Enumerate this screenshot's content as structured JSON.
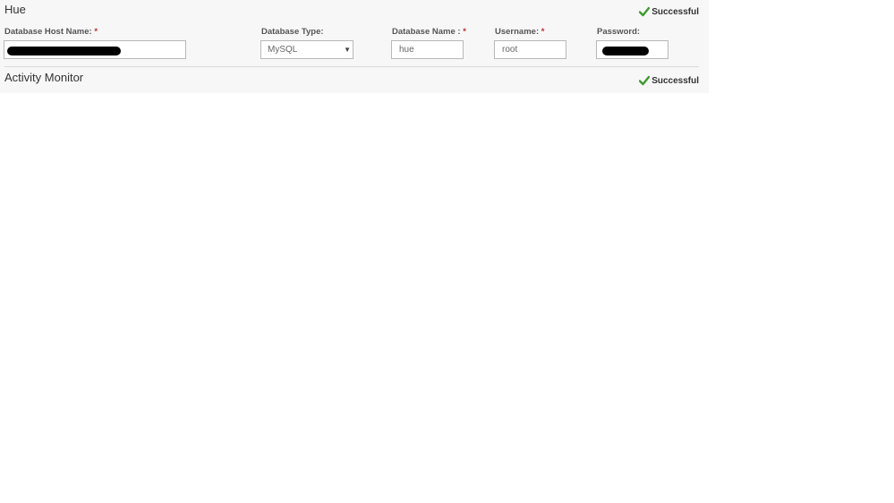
{
  "hue_section": {
    "title": "Hue",
    "status": "Successful",
    "fields": {
      "host": {
        "label": "Database Host Name:",
        "required": "*",
        "value": ""
      },
      "type": {
        "label": "Database Type:",
        "value": "MySQL"
      },
      "name": {
        "label": "Database Name :",
        "required": "*",
        "value": "hue"
      },
      "username": {
        "label": "Username:",
        "required": "*",
        "value": "root"
      },
      "password": {
        "label": "Password:",
        "value": ""
      }
    }
  },
  "activity_monitor_section": {
    "title": "Activity Monitor",
    "status": "Successful"
  },
  "colors": {
    "success_check": "#3f9a2f",
    "required_star": "#b5322c",
    "panel_bg": "#f7f7f7"
  },
  "icons": {
    "status": "checkmark-icon",
    "select": "dropdown-arrow-icon"
  }
}
